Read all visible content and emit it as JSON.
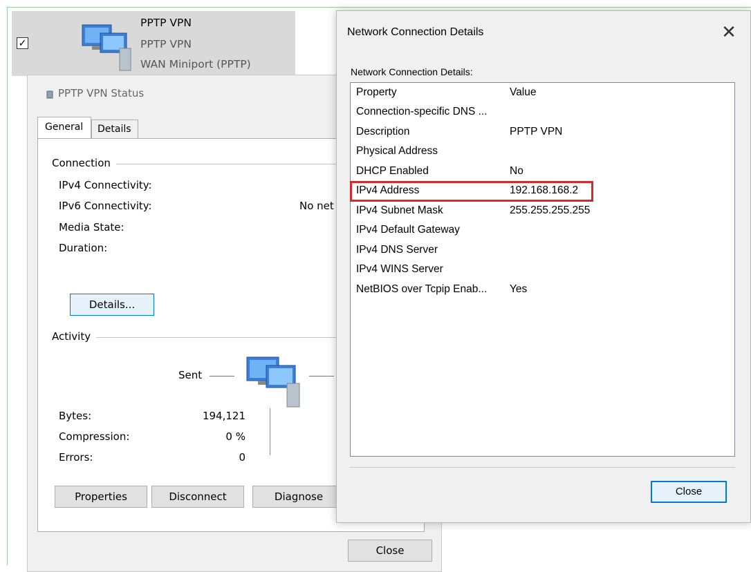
{
  "adapter": {
    "name": "PPTP VPN",
    "status": "PPTP VPN",
    "device": "WAN Miniport (PPTP)",
    "checked": true,
    "checkbox_glyph": "✓",
    "icon": "network-computers-icon"
  },
  "status_dialog": {
    "title": "PPTP VPN Status",
    "tabs": [
      "General",
      "Details"
    ],
    "connection": {
      "group_label": "Connection",
      "ipv4_label": "IPv4 Connectivity:",
      "ipv6_label": "IPv6 Connectivity:",
      "ipv6_value": "No net",
      "media_label": "Media State:",
      "duration_label": "Duration:",
      "details_button": "Details..."
    },
    "activity": {
      "group_label": "Activity",
      "sent_label": "Sent",
      "rows": [
        {
          "label": "Bytes:",
          "value": "194,121"
        },
        {
          "label": "Compression:",
          "value": "0 %"
        },
        {
          "label": "Errors:",
          "value": "0"
        }
      ]
    },
    "buttons": {
      "properties": "Properties",
      "disconnect": "Disconnect",
      "diagnose": "Diagnose",
      "close": "Close"
    }
  },
  "details_dialog": {
    "title": "Network Connection Details",
    "close_glyph": "✕",
    "subtitle": "Network Connection Details:",
    "header": {
      "property": "Property",
      "value": "Value"
    },
    "rows": [
      {
        "property": "Connection-specific DNS ...",
        "value": ""
      },
      {
        "property": "Description",
        "value": "PPTP VPN"
      },
      {
        "property": "Physical Address",
        "value": ""
      },
      {
        "property": "DHCP Enabled",
        "value": "No"
      },
      {
        "property": "IPv4 Address",
        "value": "192.168.168.2"
      },
      {
        "property": "IPv4 Subnet Mask",
        "value": "255.255.255.255"
      },
      {
        "property": "IPv4 Default Gateway",
        "value": ""
      },
      {
        "property": "IPv4 DNS Server",
        "value": ""
      },
      {
        "property": "IPv4 WINS Server",
        "value": ""
      },
      {
        "property": "NetBIOS over Tcpip Enab...",
        "value": "Yes"
      }
    ],
    "close_button": "Close",
    "highlight_color": "#d62b2b"
  }
}
